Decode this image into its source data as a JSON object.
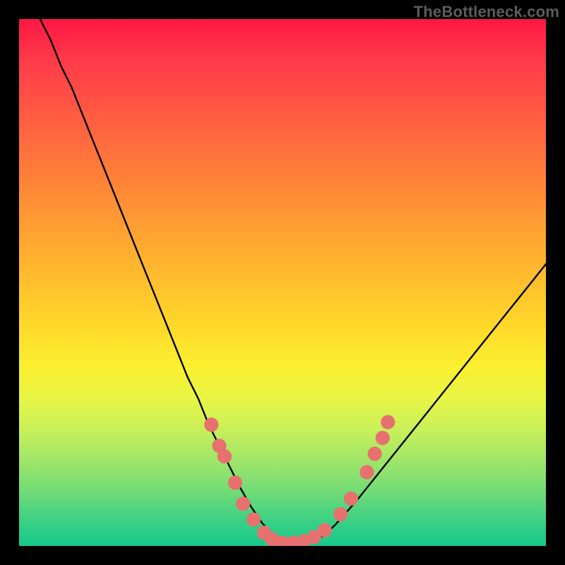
{
  "watermark": "TheBottleneck.com",
  "chart_data": {
    "type": "line",
    "title": "",
    "xlabel": "",
    "ylabel": "",
    "xlim": [
      0,
      100
    ],
    "ylim": [
      0,
      100
    ],
    "grid": false,
    "series": [
      {
        "name": "bottleneck-curve",
        "x": [
          4,
          6,
          8,
          10,
          12,
          14,
          16,
          18,
          20,
          22,
          24,
          26,
          28,
          30,
          32,
          34,
          36,
          38,
          40,
          42,
          44,
          46,
          48,
          50,
          52,
          54,
          56,
          58,
          60,
          64,
          68,
          72,
          76,
          80,
          84,
          88,
          92,
          96,
          100
        ],
        "y": [
          100,
          96,
          91,
          87,
          82,
          77,
          72,
          67,
          62,
          57,
          52,
          47,
          42,
          37,
          32,
          28,
          23,
          19,
          15,
          11,
          7.5,
          4.5,
          2.2,
          0.8,
          0.4,
          0.4,
          0.9,
          2.1,
          4.0,
          8.5,
          13.5,
          18.5,
          23.5,
          28.5,
          33.5,
          38.5,
          43.5,
          48.5,
          53.5
        ]
      }
    ],
    "markers": {
      "name": "sample-points",
      "color": "#e6716f",
      "radius_pct": 1.35,
      "points": [
        {
          "x": 36.5,
          "y": 23.0
        },
        {
          "x": 38.0,
          "y": 19.0
        },
        {
          "x": 39.0,
          "y": 17.0
        },
        {
          "x": 41.0,
          "y": 12.0
        },
        {
          "x": 42.5,
          "y": 8.0
        },
        {
          "x": 44.5,
          "y": 5.0
        },
        {
          "x": 46.5,
          "y": 2.5
        },
        {
          "x": 48.0,
          "y": 1.3
        },
        {
          "x": 50.0,
          "y": 0.6
        },
        {
          "x": 52.0,
          "y": 0.6
        },
        {
          "x": 54.0,
          "y": 0.9
        },
        {
          "x": 56.0,
          "y": 1.7
        },
        {
          "x": 58.0,
          "y": 3.0
        },
        {
          "x": 61.0,
          "y": 6.0
        },
        {
          "x": 63.0,
          "y": 9.0
        },
        {
          "x": 66.0,
          "y": 14.0
        },
        {
          "x": 67.5,
          "y": 17.5
        },
        {
          "x": 69.0,
          "y": 20.5
        },
        {
          "x": 70.0,
          "y": 23.5
        }
      ]
    }
  }
}
